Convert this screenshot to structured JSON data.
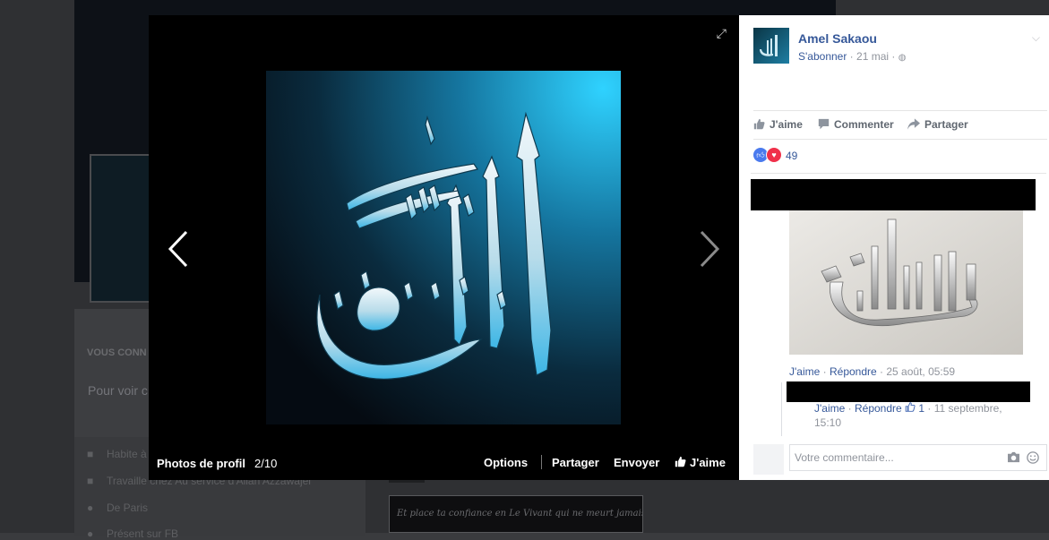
{
  "background_page": {
    "intro_heading": "VOUS CONN",
    "intro_text": "Pour voir c",
    "info_rows": [
      {
        "icon": "house-icon",
        "text": "Habite à"
      },
      {
        "icon": "briefcase-icon",
        "text": "Travaille chez Au service d'Allah Azzawajel"
      },
      {
        "icon": "location-pin-icon",
        "text": "De Paris"
      },
      {
        "icon": "clock-icon",
        "text": "Présent sur FB"
      }
    ],
    "quote_text": "Et place ta confiance en Le Vivant qui ne meurt jamais."
  },
  "viewer": {
    "album_title": "Photos de profil",
    "album_count": "2/10",
    "actions": {
      "options": "Options",
      "share": "Partager",
      "send": "Envoyer",
      "like": "J'aime"
    },
    "icons": {
      "expand": "expand-icon",
      "prev": "chevron-left-icon",
      "next": "chevron-right-icon"
    }
  },
  "post": {
    "author": "Amel Sakaou",
    "follow": "S'abonner",
    "date": "21 mai",
    "separator": " · ",
    "privacy_icon": "globe-icon",
    "actions": {
      "like": "J'aime",
      "comment": "Commenter",
      "share": "Partager"
    },
    "reaction_count": "49",
    "reactions": [
      "like",
      "love"
    ]
  },
  "comments": [
    {
      "author_redacted": true,
      "has_image": true,
      "like_label": "J'aime",
      "reply_label": "Répondre",
      "time": "25 août, 05:59"
    }
  ],
  "reply": {
    "author_redacted": true,
    "like_label": "J'aime",
    "reply_label": "Répondre",
    "like_count": "1",
    "time": "11 septembre, 15:10"
  },
  "composer": {
    "placeholder": "Votre commentaire..."
  },
  "colors": {
    "link_blue": "#365899",
    "viewer_bg": "#000000",
    "panel_bg": "#ffffff",
    "image_cyan": "#2fcaf2"
  }
}
